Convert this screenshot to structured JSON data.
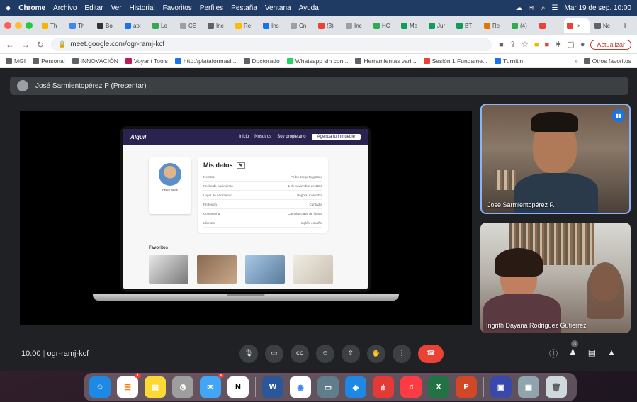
{
  "menubar": {
    "app": "Chrome",
    "items": [
      "Archivo",
      "Editar",
      "Ver",
      "Historial",
      "Favoritos",
      "Perfiles",
      "Pestaña",
      "Ventana",
      "Ayuda"
    ],
    "clock": "Mar 19 de sep.  10:00"
  },
  "tabs": [
    {
      "label": "Th",
      "color": "#f4b400"
    },
    {
      "label": "Th",
      "color": "#4285f4"
    },
    {
      "label": "Bo",
      "color": "#333333"
    },
    {
      "label": "atx",
      "color": "#1a73e8"
    },
    {
      "label": "Lo",
      "color": "#34a853"
    },
    {
      "label": "CE",
      "color": "#9aa0a6"
    },
    {
      "label": "Inc",
      "color": "#5f6368"
    },
    {
      "label": "Re",
      "color": "#fbbc05"
    },
    {
      "label": "Ins",
      "color": "#1a73e8"
    },
    {
      "label": "Cn",
      "color": "#9aa0a6"
    },
    {
      "label": "(3)",
      "color": "#ea4335"
    },
    {
      "label": "Inc",
      "color": "#9aa0a6"
    },
    {
      "label": "HC",
      "color": "#34a853"
    },
    {
      "label": "Me",
      "color": "#0f9d58"
    },
    {
      "label": "Jur",
      "color": "#0f9d58"
    },
    {
      "label": "BT",
      "color": "#0f9d58"
    },
    {
      "label": "Re",
      "color": "#e37400"
    },
    {
      "label": "(4)",
      "color": "#34a853"
    },
    {
      "label": "",
      "color": "#ea4335"
    },
    {
      "label": "",
      "color": "#ea4335",
      "active": true
    },
    {
      "label": "Nc",
      "color": "#5f6368"
    }
  ],
  "address": {
    "url": "meet.google.com/ogr-ramj-kcf",
    "update_label": "Actualizar"
  },
  "bookmarks": [
    {
      "label": "MGI",
      "color": "#5f6368"
    },
    {
      "label": "Personal",
      "color": "#5f6368"
    },
    {
      "label": "INNOVACIÓN",
      "color": "#5f6368"
    },
    {
      "label": "Voyant Tools",
      "color": "#c2185b"
    },
    {
      "label": "http://plataformasi...",
      "color": "#1a73e8"
    },
    {
      "label": "Doctorado",
      "color": "#5f6368"
    },
    {
      "label": "Whatsapp sin con...",
      "color": "#25d366"
    },
    {
      "label": "Herramientas vari...",
      "color": "#5f6368"
    },
    {
      "label": "Sesión 1 Fundame...",
      "color": "#ea4335"
    },
    {
      "label": "Turnitin",
      "color": "#1a73e8"
    }
  ],
  "bookmarks_right": "Otros favoritos",
  "presenter": "José Sarmientopérez P (Presentar)",
  "shared_site": {
    "logo": "Alquil",
    "nav_links": [
      "Inicio",
      "Nosotros",
      "Soy propietario"
    ],
    "nav_button": "Agenda tu inmueble",
    "datos_title": "Mis datos",
    "rows": [
      {
        "label": "Nombre",
        "value": "Pedro Jorge Bogotano"
      },
      {
        "label": "Fecha de nacimiento",
        "value": "1 de noviembre de 1993"
      },
      {
        "label": "Lugar de nacimiento",
        "value": "Bogotá, Colombia"
      },
      {
        "label": "Profesión",
        "value": "Contador"
      },
      {
        "label": "Contraseña",
        "value": "Cambiar clave de fuente"
      },
      {
        "label": "Idiomas",
        "value": "Inglés, español"
      }
    ],
    "profile_name": "Pedro Jorge",
    "favorites_title": "Favoritos"
  },
  "participants": [
    {
      "name": "José Sarmientopérez P."
    },
    {
      "name": "Ingrith Dayana Rodriguez Gutierrez"
    }
  ],
  "meeting": {
    "time": "10:00",
    "code": "ogr-ramj-kcf",
    "participants_count": "3"
  },
  "colors": {
    "hangup": "#ea4335",
    "meet_bg": "#202124",
    "active_speaker": "#8ab4f8"
  }
}
